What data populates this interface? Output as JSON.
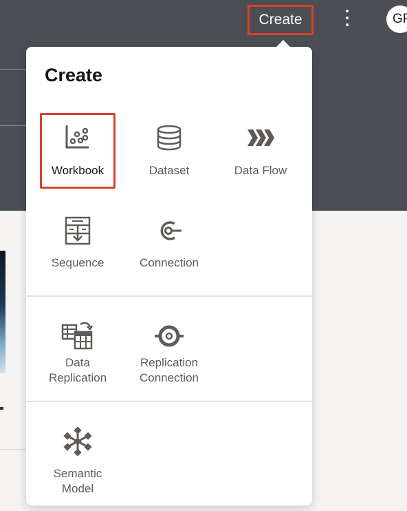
{
  "header": {
    "create_label": "Create",
    "avatar_initials": "GP"
  },
  "popup": {
    "title": "Create",
    "items": [
      {
        "label": "Workbook",
        "icon": "workbook-icon"
      },
      {
        "label": "Dataset",
        "icon": "dataset-icon"
      },
      {
        "label": "Data Flow",
        "icon": "data-flow-icon"
      },
      {
        "label": "Sequence",
        "icon": "sequence-icon"
      },
      {
        "label": "Connection",
        "icon": "connection-icon"
      },
      {
        "label": "Data\nReplication",
        "icon": "data-replication-icon"
      },
      {
        "label": "Replication\nConnection",
        "icon": "replication-connection-icon"
      },
      {
        "label": "Semantic\nModel",
        "icon": "semantic-model-icon"
      }
    ],
    "selected_item": "Workbook"
  },
  "colors": {
    "header_bg": "#4b4e52",
    "highlight": "#d6432d",
    "icon": "#5f5c58",
    "label": "#5f5c58"
  }
}
